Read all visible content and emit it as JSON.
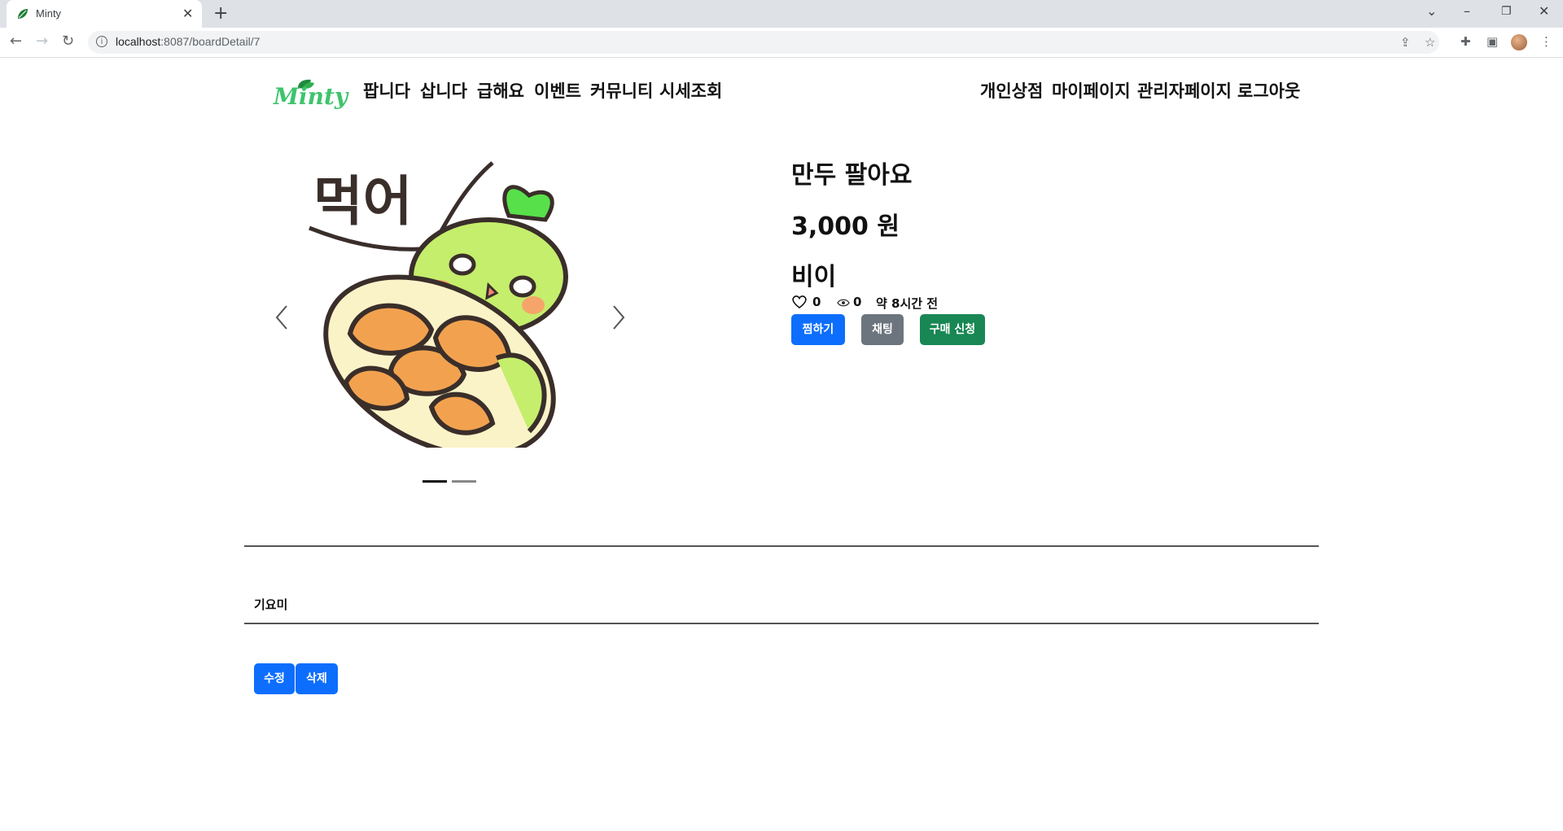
{
  "browser": {
    "tab_title": "Minty",
    "new_tab": "+",
    "close": "✕",
    "url_host": "localhost",
    "url_rest": ":8087/boardDetail/7"
  },
  "nav": {
    "left": [
      "팝니다",
      "삽니다",
      "급해요",
      "이벤트",
      "커뮤니티",
      "시세조회"
    ],
    "right": [
      "개인상점",
      "마이페이지",
      "관리자페이지",
      "로그아웃"
    ],
    "logo_text": "Minty"
  },
  "product": {
    "title": "만두 팔아요",
    "price": "3,000 원",
    "seller": "비이",
    "likes": "0",
    "views": "0",
    "time_ago": "약 8시간 전"
  },
  "image": {
    "caption": "먹어"
  },
  "buttons": {
    "wish": "찜하기",
    "chat": "채팅",
    "buy": "구매 신청",
    "edit": "수정",
    "delete": "삭제"
  },
  "content": {
    "body": "기요미"
  },
  "carousel": {
    "active_index": 0,
    "slide_count": 2
  },
  "colors": {
    "primary": "#0d6efd",
    "secondary": "#6c757d",
    "success": "#198754",
    "logo_green": "#3ec46d"
  }
}
